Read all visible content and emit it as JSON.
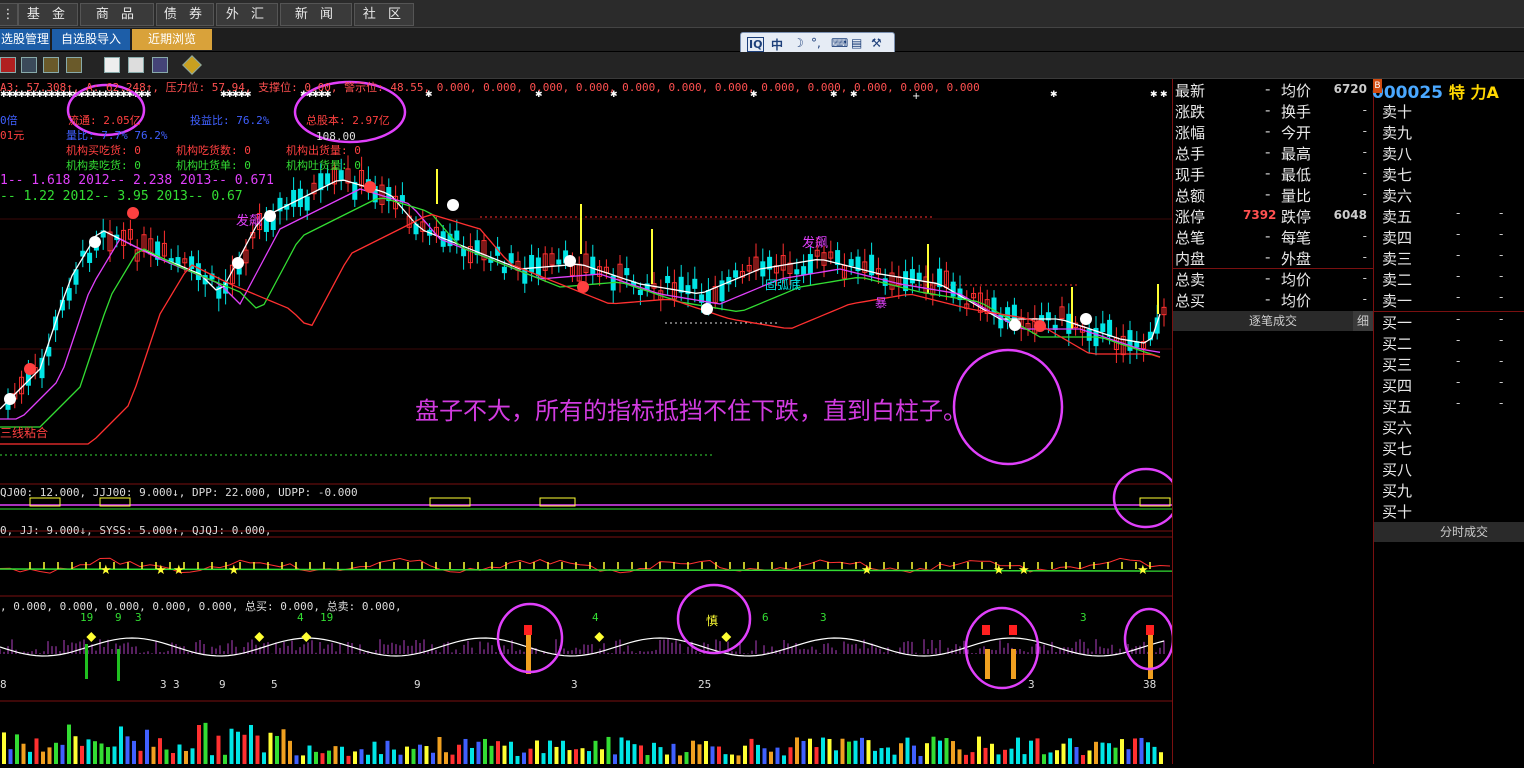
{
  "topnav": {
    "tabs": [
      "基 金",
      "商 品",
      "债 券",
      "外 汇",
      "新 闻",
      "社 区"
    ]
  },
  "subnav": {
    "items": [
      "选股管理",
      "自选股导入",
      "近期浏览"
    ]
  },
  "ime": {
    "label": "中"
  },
  "chart_header": {
    "line1": "A3: 57.308↑, A: 62.248↑, 压力位: 57.94, 支撑位: 0.00, 警示位: 48.55, 0.000, 0.000, 0.000, 0.000, 0.000, 0.000, 0.000, 0.000, 0.000, 0.000, 0.000, 0.000",
    "liutong": "流通: 2.05亿",
    "zongguben": "总股本: 2.97亿",
    "shouyi": "投益比: 76.2%",
    "liangbi": "量比: 7.7% 76.2%",
    "b108": "108.00",
    "jg1": "机构买吃货: 0",
    "jg2": "机构吃货数: 0",
    "jg3": "机构出货量: 0",
    "jg4": "机构卖吃货: 0",
    "jg5": "机构吐货单: 0",
    "jg6": "机构吐货量: 0",
    "y1": "1-- 1.618    2012-- 2.238    2013-- 0.671",
    "y2": "-- 1.22    2012-- 3.95    2013-- 0.67",
    "beishu": "0倍",
    "yuan": "01元",
    "fapiao1": "发飙",
    "fapiao2": "发飙",
    "guanhu": "固弧底",
    "baoxian": "暴",
    "sanxian": "三线粘合",
    "shen": "慎"
  },
  "overlay_text": "盘子不大，所有的指标抵挡不住下跌，直到白柱子。",
  "ind1": {
    "header": "QJ00: 12.000, JJJ00: 9.000↓, DPP: 22.000, UDPP: -0.000"
  },
  "ind2": {
    "header": "0, JJ: 9.000↓, SYSS: 5.000↑, QJQJ: 0.000,"
  },
  "ind3": {
    "header": ", 0.000, 0.000, 0.000, 0.000, 0.000, 总买: 0.000, 总卖: 0.000,"
  },
  "ind3_nums": {
    "n1": "19",
    "n2": "9",
    "n3": "3",
    "n4": "4",
    "n5": "19",
    "n6": "4",
    "n7": "6",
    "n8": "3",
    "n9": "3",
    "m1": "8",
    "m2": "3",
    "m3": "3",
    "m4": "9",
    "m5": "5",
    "m6": "9",
    "m7": "3",
    "m8": "25",
    "m9": "3",
    "m10": "38"
  },
  "stock": {
    "code": "000025",
    "name": "特 力A",
    "price_partial": "6720"
  },
  "quote_rows": [
    {
      "l": "最新",
      "r": "均价",
      "v": "6720"
    },
    {
      "l": "涨跌",
      "r": "换手",
      "v": ""
    },
    {
      "l": "涨幅",
      "r": "今开",
      "v": ""
    },
    {
      "l": "总手",
      "r": "最高",
      "v": ""
    },
    {
      "l": "现手",
      "r": "最低",
      "v": ""
    },
    {
      "l": "总额",
      "r": "量比",
      "v": ""
    },
    {
      "l": "涨停",
      "r": "跌停",
      "lv": "7392",
      "v": "6048"
    },
    {
      "l": "总笔",
      "r": "每笔",
      "v": ""
    },
    {
      "l": "内盘",
      "r": "外盘",
      "v": ""
    }
  ],
  "quote_rows2": [
    {
      "l": "总卖",
      "r": "均价",
      "v": ""
    },
    {
      "l": "总买",
      "r": "均价",
      "v": ""
    }
  ],
  "dash": "-",
  "zhubi": {
    "label": "逐笔成交",
    "detail": "细"
  },
  "fenshi": {
    "label": "分时成交"
  },
  "sells": [
    "卖十",
    "卖九",
    "卖八",
    "卖七",
    "卖六",
    "卖五",
    "卖四",
    "卖三",
    "卖二",
    "卖一"
  ],
  "buys": [
    "买一",
    "买二",
    "买三",
    "买四",
    "买五",
    "买六",
    "买七",
    "买八",
    "买九",
    "买十"
  ],
  "colors": {
    "up": "#ff3030",
    "down": "#00e5e5",
    "white_line": "#ffffff",
    "yellow": "#ffff33",
    "magenta": "#e040fb",
    "green": "#33dd33"
  }
}
